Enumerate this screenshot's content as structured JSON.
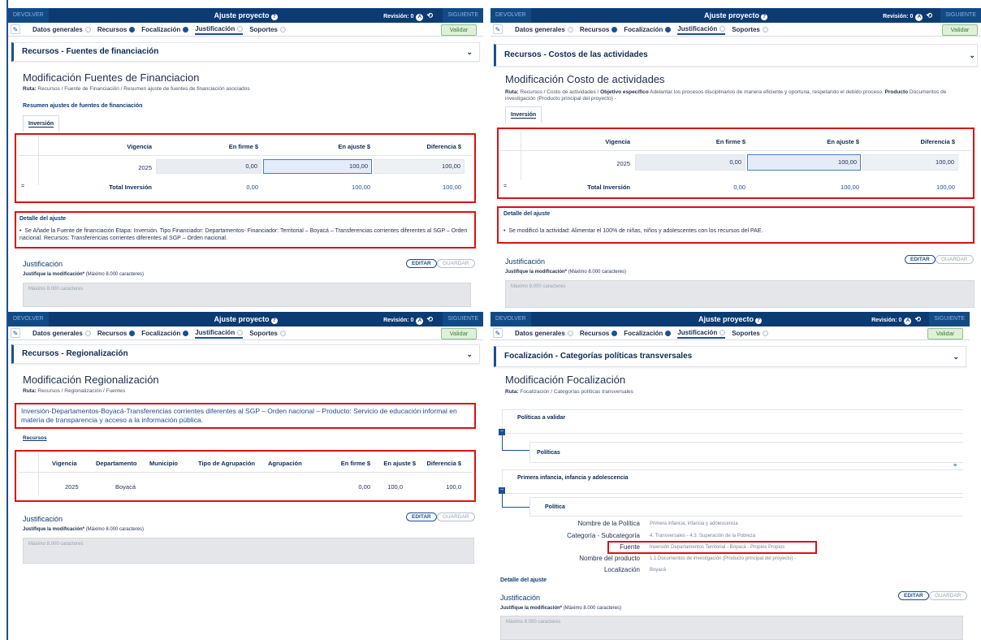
{
  "common": {
    "devolver": "DEVOLVER",
    "siguiente": "SIGUIENTE",
    "title": "Ajuste proyecto",
    "revision": "Revisión: 0",
    "tabs": [
      {
        "label": "Datos generales",
        "filled": false
      },
      {
        "label": "Recursos",
        "filled": true
      },
      {
        "label": "Focalización",
        "filled": true
      },
      {
        "label": "Justificación",
        "filled": false
      },
      {
        "label": "Soportes",
        "filled": false
      }
    ],
    "validar": "Validar",
    "editar": "EDITAR",
    "guardar": "GUARDAR",
    "justificacion": "Justificación",
    "justifique": "Justifique la modificación*",
    "maximo_hint": "(Máximo 8.000 caracteres)",
    "placeholder": "Máximo 8.000 caracteres",
    "detalle": "Detalle del ajuste"
  },
  "p1": {
    "accordion": "Recursos - Fuentes de financiación",
    "title": "Modificación Fuentes de Financiacion",
    "ruta_label": "Ruta:",
    "ruta": "Recursos / Fuente de Financiación / Resumen ajuste de fuentes de financiación asociados",
    "subtitle": "Resumen ajustes de fuentes de financiación",
    "subtab": "Inversión",
    "cols": [
      "Vigencia",
      "En firme $",
      "En ajuste $",
      "Diferencia $"
    ],
    "row": [
      "2025",
      "0,00",
      "100,00",
      "100,00"
    ],
    "total": [
      "Total Inversión",
      "0,00",
      "100,00",
      "100,00"
    ],
    "detail": "Se Añade la Fuente de financiación Etapa: Inversión. Tipo Financiador: Departamentos- Financiador: Territorial – Boyacá – Transferencias corrientes diferentes al SGP – Orden nacional. Recursos: Transferencias corrientes diferentes al SGP – Orden nacional."
  },
  "p2": {
    "accordion": "Recursos - Costos de las actividades",
    "title": "Modificación Costo de actividades",
    "ruta_label": "Ruta:",
    "ruta_a": "Recursos / Costo de actividades / ",
    "obj_label": "Objetivo específico",
    "ruta_b": " Adelantar los procesos disciplinarios de manera eficiente y oportuna, respetando el debido proceso. ",
    "prod_label": "Producto",
    "ruta_c": "Documentos de investigación (Producto principal del proyecto) -",
    "subtab": "Inversión",
    "cols": [
      "Vigencia",
      "En firme $",
      "En ajuste $",
      "Diferencia $"
    ],
    "row": [
      "2025",
      "0,00",
      "100,00",
      "100,00"
    ],
    "total": [
      "Total Inversión",
      "0,00",
      "100,00",
      "100,00"
    ],
    "detail": "Se modificó la actividad: Alimentar el 100% de niñas, niños y adolescentes con los recursos del PAE."
  },
  "p3": {
    "accordion": "Recursos - Regionalización",
    "title": "Modificación Regionalización",
    "ruta_label": "Ruta:",
    "ruta": "Recursos / Regionalización / Fuentes",
    "fuente": "Inversión-Departamentos-Boyacá-Transferencias corrientes diferentes al SGP – Orden nacional – Producto: Servicio de educación informal en materia de transparencia y acceso a la información pública.",
    "link": "Recursos",
    "cols": [
      "Vigencia",
      "Departamento",
      "Municipio",
      "Tipo de Agrupación",
      "Agrupación",
      "En firme $",
      "En ajuste $",
      "Diferencia $"
    ],
    "row": [
      "2025",
      "Boyacá",
      "",
      "",
      "",
      "0,00",
      "100,0",
      "100,0"
    ]
  },
  "p4": {
    "accordion": "Focalización - Categorías políticas transversales",
    "title": "Modificación Focalización",
    "ruta_label": "Ruta:",
    "ruta": "Focalización / Categorías políticas transversales",
    "politicas_validar": "Políticas a validar",
    "politicas": "Políticas",
    "categoria": "Primera infancia, infancia y adolescencia",
    "politica": "Política",
    "kv": [
      {
        "k": "Nombre de la Política",
        "v": "Primera infancia, infancia y adolescencia"
      },
      {
        "k": "Categoría - Subcategoría",
        "v": "4. Transversales - 4.3. Superación de la Pobreza"
      },
      {
        "k": "Fuente",
        "v": "Inversión Departamentos Territorial - Boyacá - Propios Propios"
      },
      {
        "k": "Nombre del producto",
        "v": "1.1.Documentos de investigación (Producto principal del proyecto) -"
      },
      {
        "k": "Localización",
        "v": "Boyacá"
      }
    ]
  }
}
